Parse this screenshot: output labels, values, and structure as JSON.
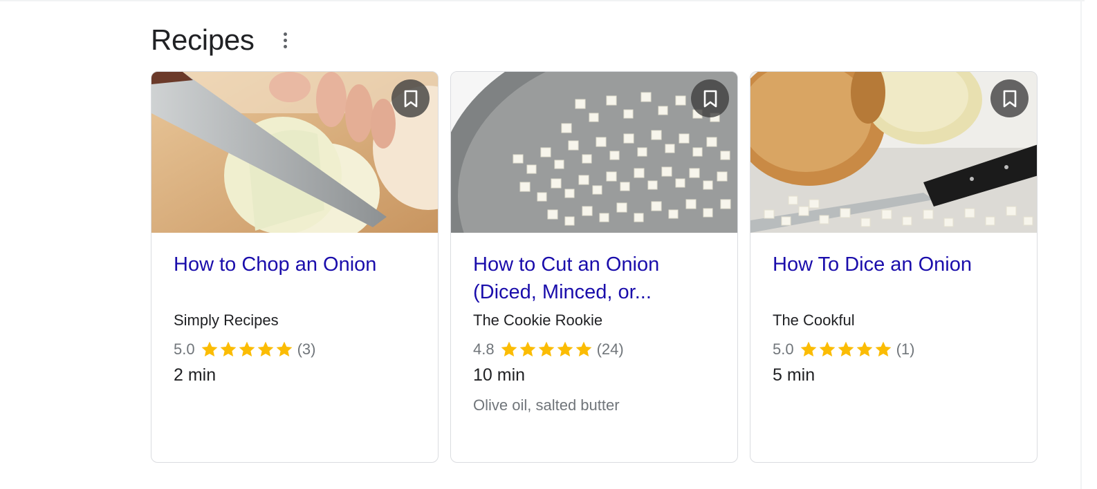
{
  "section": {
    "title": "Recipes",
    "more_icon": "more-vert-icon"
  },
  "colors": {
    "link": "#1a0dab",
    "star": "#fbbc04",
    "muted": "#70757a",
    "text": "#202124"
  },
  "cards": [
    {
      "title": "How to Chop an Onion",
      "source": "Simply Recipes",
      "rating": "5.0",
      "stars": 5,
      "reviews": "(3)",
      "time": "2 min",
      "ingredients": "",
      "image": "knife-chopping-onion-image",
      "bookmark_icon": "bookmark-icon"
    },
    {
      "title": "How to Cut an Onion (Diced, Minced, or...",
      "source": "The Cookie Rookie",
      "rating": "4.8",
      "stars": 4.8,
      "reviews": "(24)",
      "time": "10 min",
      "ingredients": "Olive oil, salted butter",
      "image": "diced-onion-pan-image",
      "bookmark_icon": "bookmark-icon"
    },
    {
      "title": "How To Dice an Onion",
      "source": "The Cookful",
      "rating": "5.0",
      "stars": 5,
      "reviews": "(1)",
      "time": "5 min",
      "ingredients": "",
      "image": "whole-onions-knife-image",
      "bookmark_icon": "bookmark-icon"
    }
  ]
}
